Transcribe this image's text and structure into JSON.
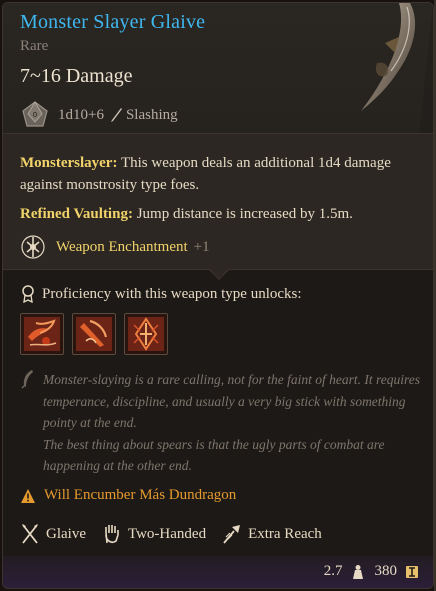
{
  "item": {
    "name": "Monster Slayer Glaive",
    "rarity": "Rare",
    "damage": "7~16 Damage",
    "dice": "1d10+6",
    "damage_type": "Slashing"
  },
  "properties": {
    "monsterslayer_name": "Monsterslayer:",
    "monsterslayer_desc": "This weapon deals an additional 1d4 damage against monstrosity type foes.",
    "vaulting_name": "Refined Vaulting:",
    "vaulting_desc": "Jump distance is increased by 1.5m.",
    "enchant_label": "Weapon Enchantment",
    "enchant_mod": "+1"
  },
  "proficiency": {
    "label": "Proficiency with this weapon type unlocks:",
    "actions": [
      "bleed-attack-icon",
      "weakening-strike-icon",
      "piercing-thrust-icon"
    ]
  },
  "lore": {
    "line1": "Monster-slaying is a rare calling, not for the faint of heart. It requires temperance, discipline, and usually a very big stick with something pointy at the end.",
    "line2": "The best thing about spears is that the ugly parts of combat are happening at the other end."
  },
  "encumber": {
    "text": "Will Encumber Más Dundragon"
  },
  "tags": [
    {
      "label": "Glaive",
      "icon": "glaive-icon"
    },
    {
      "label": "Two-Handed",
      "icon": "two-handed-icon"
    },
    {
      "label": "Extra Reach",
      "icon": "extra-reach-icon"
    }
  ],
  "footer": {
    "weight": "2.7",
    "price": "380"
  },
  "colors": {
    "title": "#3fb8f0",
    "property_name": "#f2d36b",
    "warning": "#e59a2e",
    "lore": "#7e766c"
  }
}
